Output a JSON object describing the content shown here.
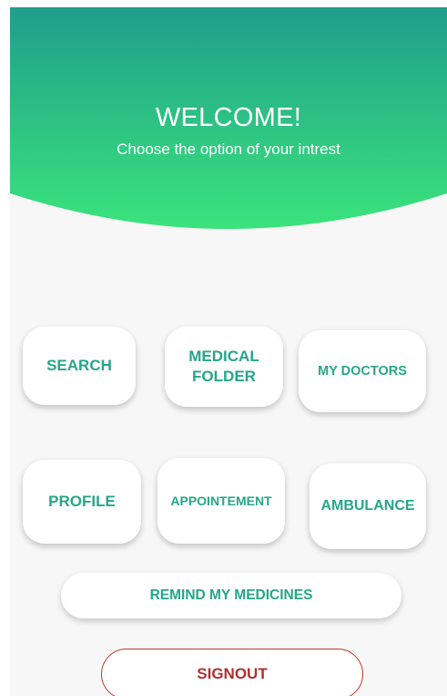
{
  "header": {
    "title": "WELCOME!",
    "subtitle": "Choose the option of your intrest"
  },
  "menu": {
    "search": "SEARCH",
    "medical_folder": "MEDICAL FOLDER",
    "my_doctors": "MY DOCTORS",
    "profile": "PROFILE",
    "appointment": "APPOINTEMENT",
    "ambulance": "AMBULANCE",
    "remind_medicines": "REMIND MY MEDICINES"
  },
  "signout_label": "SIGNOUT",
  "colors": {
    "header_gradient_top": "#1f9e8c",
    "header_gradient_bottom": "#3be37c",
    "accent_text": "#26a68a",
    "signout_text": "#b03030",
    "signout_border": "#c0392b",
    "background": "#f7f7f7"
  }
}
